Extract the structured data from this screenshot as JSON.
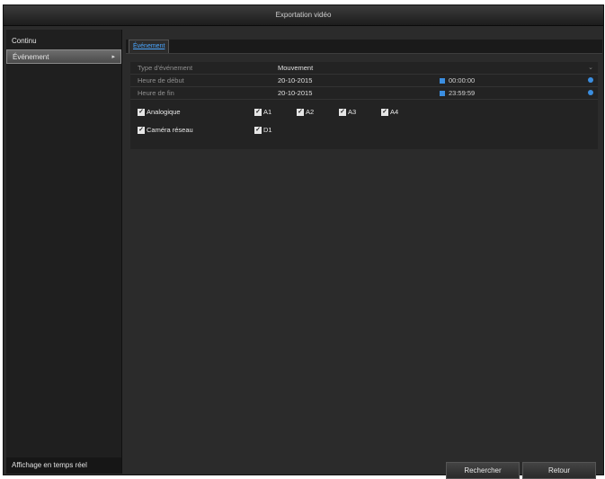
{
  "window": {
    "title": "Exportation vidéo"
  },
  "sidebar": {
    "items": [
      {
        "label": "Continu",
        "selected": false
      },
      {
        "label": "Événement",
        "selected": true,
        "arrow": "▸"
      }
    ],
    "live_view_label": "Affichage en temps réel"
  },
  "tabs": [
    {
      "label": "Événement",
      "active": true
    }
  ],
  "form": {
    "event_type": {
      "label": "Type d'événement",
      "value": "Mouvement"
    },
    "start": {
      "label": "Heure de début",
      "date": "20-10-2015",
      "time": "00:00:00"
    },
    "end": {
      "label": "Heure de fin",
      "date": "20-10-2015",
      "time": "23:59:59"
    }
  },
  "analog": {
    "label": "Analogique",
    "checked": true,
    "channels": [
      {
        "label": "A1",
        "checked": true
      },
      {
        "label": "A2",
        "checked": true
      },
      {
        "label": "A3",
        "checked": true
      },
      {
        "label": "A4",
        "checked": true
      }
    ]
  },
  "network": {
    "label": "Caméra réseau",
    "checked": true,
    "channels": [
      {
        "label": "D1",
        "checked": true
      }
    ]
  },
  "buttons": {
    "search_label": "Rechercher",
    "back_label": "Retour"
  },
  "colors": {
    "accent": "#3b8ee0",
    "tab_text": "#4aa6ff",
    "background": "#2b2b2b"
  }
}
